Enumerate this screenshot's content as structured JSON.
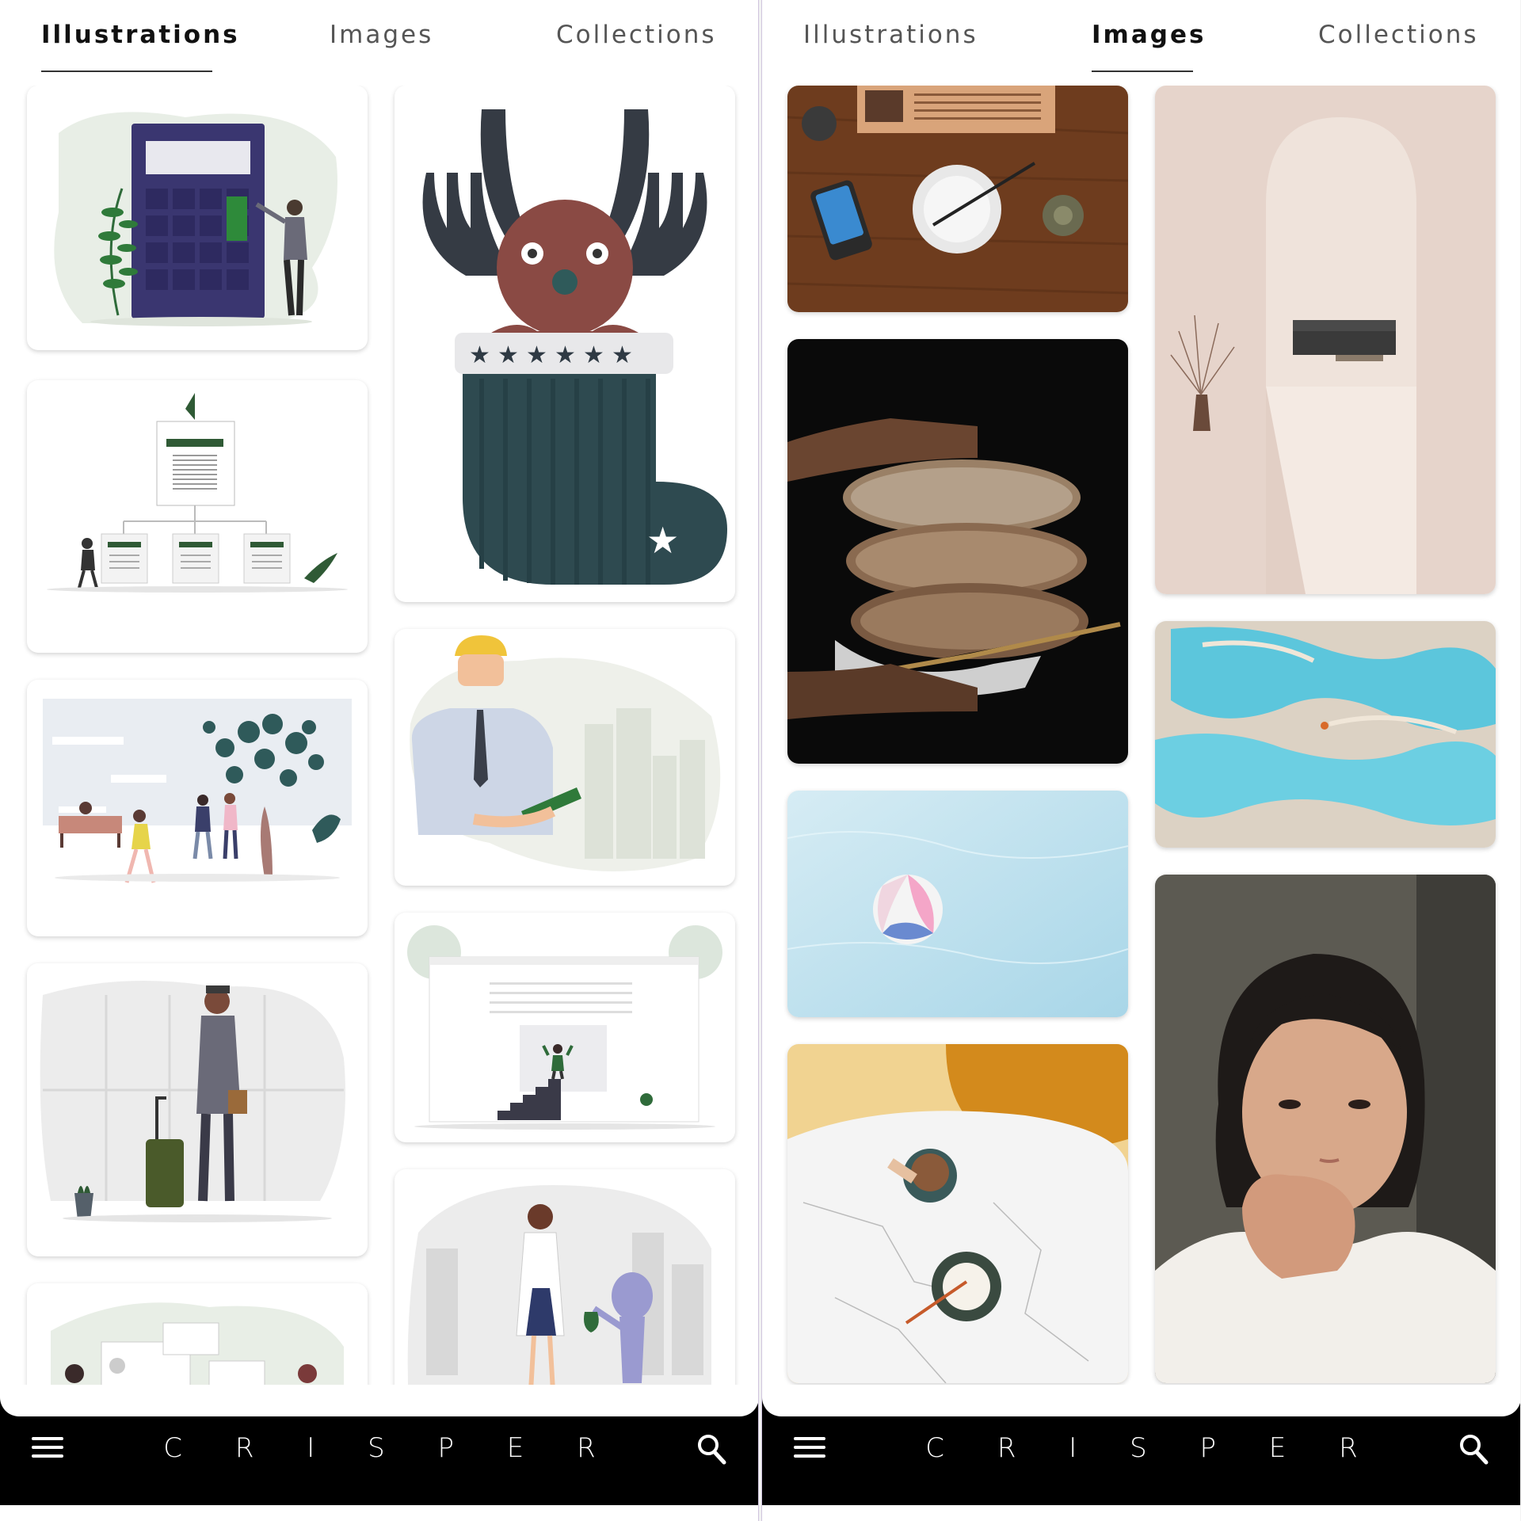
{
  "screens": [
    {
      "tabs": [
        {
          "label": "Illustrations",
          "active": true
        },
        {
          "label": "Images",
          "active": false
        },
        {
          "label": "Collections",
          "active": false
        }
      ],
      "brand": "C R I S P E R",
      "cards": [
        {
          "subject": "calculator-illustration"
        },
        {
          "subject": "reindeer-stocking-illustration"
        },
        {
          "subject": "document-hierarchy-illustration"
        },
        {
          "subject": "engineer-tablet-illustration"
        },
        {
          "subject": "park-people-illustration"
        },
        {
          "subject": "website-stairs-illustration"
        },
        {
          "subject": "traveler-phone-illustration"
        },
        {
          "subject": "scientist-alien-illustration"
        },
        {
          "subject": "team-meeting-illustration"
        }
      ]
    },
    {
      "tabs": [
        {
          "label": "Illustrations",
          "active": false
        },
        {
          "label": "Images",
          "active": true
        },
        {
          "label": "Collections",
          "active": false
        }
      ],
      "brand": "C R I S P E R",
      "cards": [
        {
          "subject": "table-bowl-phone-photo"
        },
        {
          "subject": "interior-arch-photo"
        },
        {
          "subject": "bread-loaves-photo"
        },
        {
          "subject": "turquoise-pools-photo"
        },
        {
          "subject": "beach-ball-water-photo"
        },
        {
          "subject": "woman-portrait-photo"
        },
        {
          "subject": "marble-table-cups-photo"
        }
      ]
    }
  ],
  "colors": {
    "accent_dark": "#111111",
    "tab_inactive": "#555555",
    "bar": "#000000",
    "illustration_green": "#2f6b3a",
    "illustration_navy": "#33316a"
  }
}
